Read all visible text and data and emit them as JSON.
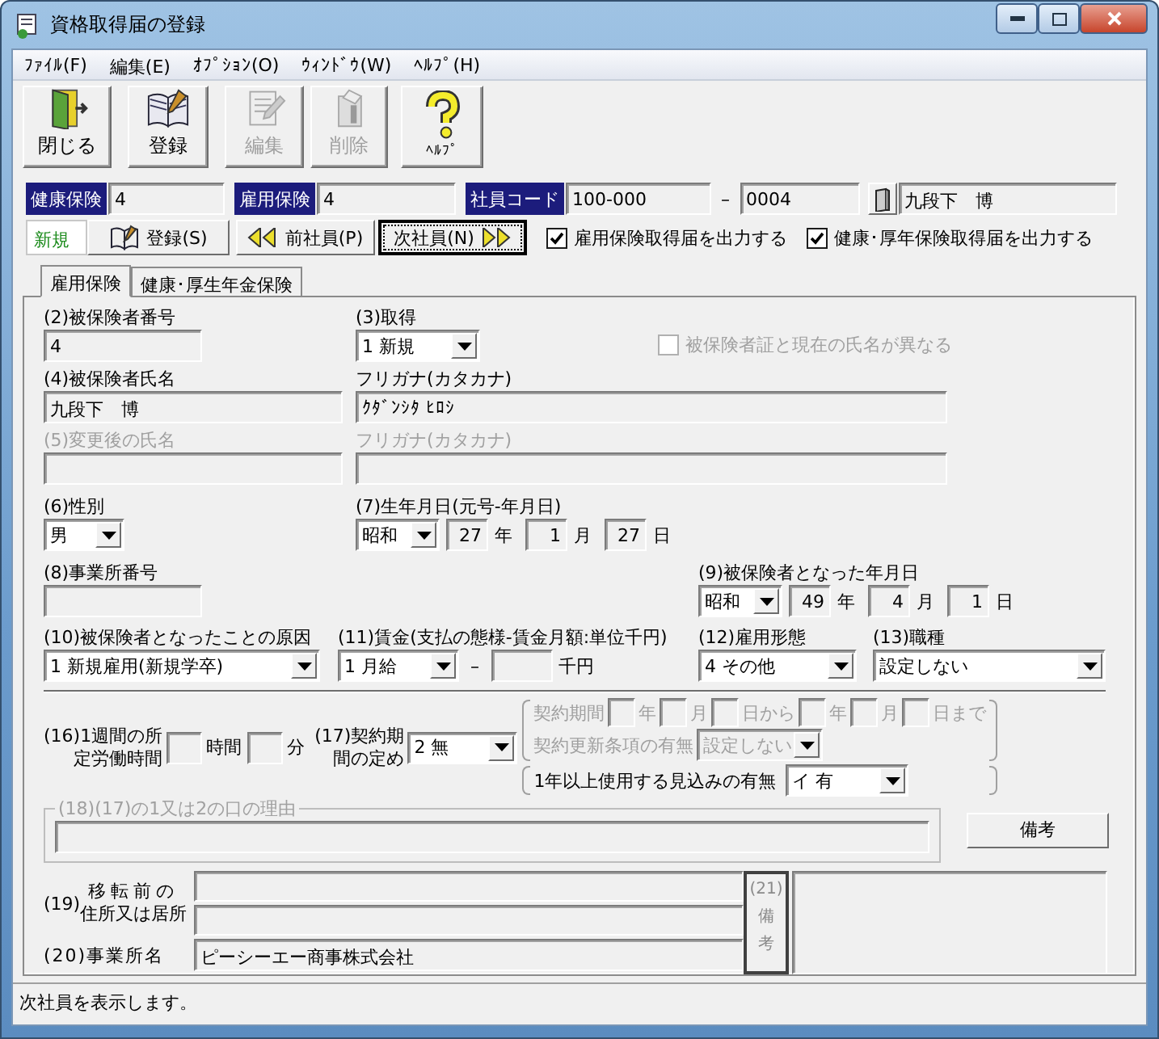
{
  "window": {
    "title": "資格取得届の登録"
  },
  "menu": [
    {
      "label": "ﾌｧｲﾙ(F)"
    },
    {
      "label": "編集(E)"
    },
    {
      "label": "ｵﾌﾟｼｮﾝ(O)"
    },
    {
      "label": "ｳｨﾝﾄﾞｳ(W)"
    },
    {
      "label": "ﾍﾙﾌﾟ(H)"
    }
  ],
  "toolbar": [
    {
      "kind": "close",
      "label": "閉じる",
      "disabled": false
    },
    {
      "kind": "register",
      "label": "登録",
      "disabled": false
    },
    {
      "kind": "edit",
      "label": "編集",
      "disabled": true
    },
    {
      "kind": "delete",
      "label": "削除",
      "disabled": true
    },
    {
      "kind": "help",
      "label": "ﾍﾙﾌﾟ",
      "disabled": false
    }
  ],
  "header": {
    "health": {
      "label": "健康保険",
      "value": "4"
    },
    "employment": {
      "label": "雇用保険",
      "value": "4"
    },
    "employee_code": {
      "label": "社員コード",
      "value": "100-000",
      "separator": "–",
      "branch": "0004"
    },
    "employee_name": "九段下　博"
  },
  "actions": {
    "mode": "新規",
    "buttons": [
      {
        "kind": "register",
        "label": "登録(S)",
        "focused": false
      },
      {
        "kind": "prev",
        "label": "前社員(P)",
        "focused": false
      },
      {
        "kind": "next",
        "label": "次社員(N)",
        "focused": true
      }
    ],
    "outputs": [
      {
        "label": "雇用保険取得届を出力する",
        "checked": true
      },
      {
        "label": "健康･厚年保険取得届を出力する",
        "checked": true
      }
    ]
  },
  "tabs": [
    {
      "label": "雇用保険",
      "selected": true
    },
    {
      "label": "健康･厚生年金保険",
      "selected": false
    }
  ],
  "form": {
    "insured_number": {
      "label": "(2)被保険者番号",
      "value": "4"
    },
    "acquisition": {
      "label": "(3)取得",
      "value": "1 新規"
    },
    "name_differs": {
      "label": "被保険者証と現在の氏名が異なる",
      "checked": false,
      "disabled": true
    },
    "insured_name": {
      "label": "(4)被保険者氏名",
      "value": "九段下　博"
    },
    "insured_kana": {
      "label": "フリガナ(カタカナ)",
      "value": "ｸﾀﾞﾝｼﾀ ﾋﾛｼ"
    },
    "changed_name": {
      "label": "(5)変更後の氏名",
      "disabled": true
    },
    "changed_kana": {
      "label": "フリガナ(カタカナ)",
      "disabled": true
    },
    "sex": {
      "label": "(6)性別",
      "value": "男"
    },
    "birth_date": {
      "label": "(7)生年月日(元号-年月日)",
      "era": "昭和",
      "parts": [
        {
          "value": "27",
          "unit": "年"
        },
        {
          "value": "1",
          "unit": "月"
        },
        {
          "value": "27",
          "unit": "日"
        }
      ]
    },
    "office_number": {
      "label": "(8)事業所番号"
    },
    "insured_date": {
      "label": "(9)被保険者となった年月日",
      "era": "昭和",
      "parts": [
        {
          "value": "49",
          "unit": "年"
        },
        {
          "value": "4",
          "unit": "月"
        },
        {
          "value": "1",
          "unit": "日"
        }
      ]
    },
    "cause": {
      "label": "(10)被保険者となったことの原因",
      "value": "1 新規雇用(新規学卒)"
    },
    "wage": {
      "label": "(11)賃金(支払の態様-賃金月額:単位千円)",
      "type": "1 月給",
      "separator": "–",
      "unit": "千円"
    },
    "employment_type": {
      "label": "(12)雇用形態",
      "value": "4 その他"
    },
    "occupation": {
      "label": "(13)職種",
      "value": "設定しない"
    },
    "weekly_hours": {
      "label_lines": [
        "(16)1週間の所",
        "定労働時間"
      ],
      "units": [
        "時間",
        "分"
      ]
    },
    "contract_term": {
      "label_lines": [
        "(17)契約期",
        "間の定め"
      ],
      "value": "2 無"
    },
    "contract_period": {
      "disabled": true,
      "label": "契約期間",
      "units": [
        "年",
        "月",
        "日から",
        "年",
        "月",
        "日まで"
      ],
      "renewal_label": "契約更新条項の有無",
      "renewal_value": "設定しない"
    },
    "long_term": {
      "label": "1年以上使用する見込みの有無",
      "value": "イ 有"
    },
    "reason": {
      "legend": "(18)(17)の1又は2の口の理由",
      "disabled": true
    },
    "remarks_button": "備考",
    "previous_address": {
      "number": "(19)",
      "label_lines": [
        "移転前の",
        "住所又は居所"
      ]
    },
    "office_name": {
      "label": "(20)事業所名",
      "value": "ピーシーエー商事株式会社"
    },
    "remarks": {
      "label_lines": [
        "(21)",
        "備",
        "考"
      ]
    }
  },
  "status_bar": "次社員を表示します。"
}
